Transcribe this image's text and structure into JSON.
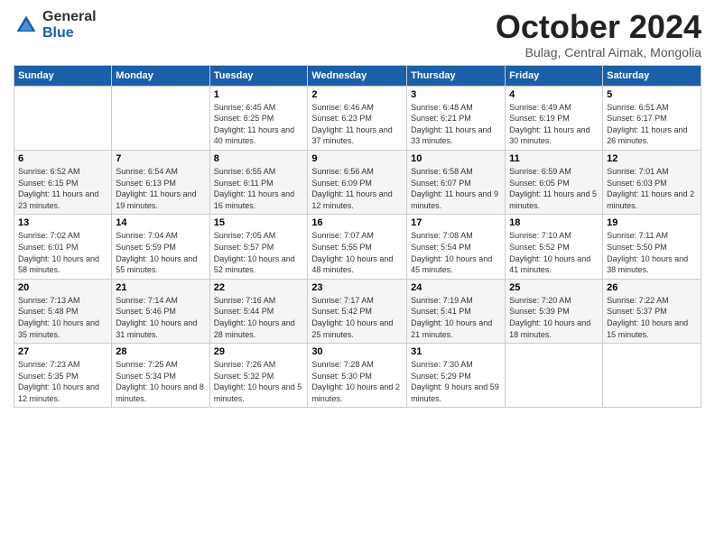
{
  "logo": {
    "general": "General",
    "blue": "Blue"
  },
  "header": {
    "month": "October 2024",
    "location": "Bulag, Central Aimak, Mongolia"
  },
  "weekdays": [
    "Sunday",
    "Monday",
    "Tuesday",
    "Wednesday",
    "Thursday",
    "Friday",
    "Saturday"
  ],
  "weeks": [
    [
      {
        "day": "",
        "info": ""
      },
      {
        "day": "",
        "info": ""
      },
      {
        "day": "1",
        "info": "Sunrise: 6:45 AM\nSunset: 6:25 PM\nDaylight: 11 hours and 40 minutes."
      },
      {
        "day": "2",
        "info": "Sunrise: 6:46 AM\nSunset: 6:23 PM\nDaylight: 11 hours and 37 minutes."
      },
      {
        "day": "3",
        "info": "Sunrise: 6:48 AM\nSunset: 6:21 PM\nDaylight: 11 hours and 33 minutes."
      },
      {
        "day": "4",
        "info": "Sunrise: 6:49 AM\nSunset: 6:19 PM\nDaylight: 11 hours and 30 minutes."
      },
      {
        "day": "5",
        "info": "Sunrise: 6:51 AM\nSunset: 6:17 PM\nDaylight: 11 hours and 26 minutes."
      }
    ],
    [
      {
        "day": "6",
        "info": "Sunrise: 6:52 AM\nSunset: 6:15 PM\nDaylight: 11 hours and 23 minutes."
      },
      {
        "day": "7",
        "info": "Sunrise: 6:54 AM\nSunset: 6:13 PM\nDaylight: 11 hours and 19 minutes."
      },
      {
        "day": "8",
        "info": "Sunrise: 6:55 AM\nSunset: 6:11 PM\nDaylight: 11 hours and 16 minutes."
      },
      {
        "day": "9",
        "info": "Sunrise: 6:56 AM\nSunset: 6:09 PM\nDaylight: 11 hours and 12 minutes."
      },
      {
        "day": "10",
        "info": "Sunrise: 6:58 AM\nSunset: 6:07 PM\nDaylight: 11 hours and 9 minutes."
      },
      {
        "day": "11",
        "info": "Sunrise: 6:59 AM\nSunset: 6:05 PM\nDaylight: 11 hours and 5 minutes."
      },
      {
        "day": "12",
        "info": "Sunrise: 7:01 AM\nSunset: 6:03 PM\nDaylight: 11 hours and 2 minutes."
      }
    ],
    [
      {
        "day": "13",
        "info": "Sunrise: 7:02 AM\nSunset: 6:01 PM\nDaylight: 10 hours and 58 minutes."
      },
      {
        "day": "14",
        "info": "Sunrise: 7:04 AM\nSunset: 5:59 PM\nDaylight: 10 hours and 55 minutes."
      },
      {
        "day": "15",
        "info": "Sunrise: 7:05 AM\nSunset: 5:57 PM\nDaylight: 10 hours and 52 minutes."
      },
      {
        "day": "16",
        "info": "Sunrise: 7:07 AM\nSunset: 5:55 PM\nDaylight: 10 hours and 48 minutes."
      },
      {
        "day": "17",
        "info": "Sunrise: 7:08 AM\nSunset: 5:54 PM\nDaylight: 10 hours and 45 minutes."
      },
      {
        "day": "18",
        "info": "Sunrise: 7:10 AM\nSunset: 5:52 PM\nDaylight: 10 hours and 41 minutes."
      },
      {
        "day": "19",
        "info": "Sunrise: 7:11 AM\nSunset: 5:50 PM\nDaylight: 10 hours and 38 minutes."
      }
    ],
    [
      {
        "day": "20",
        "info": "Sunrise: 7:13 AM\nSunset: 5:48 PM\nDaylight: 10 hours and 35 minutes."
      },
      {
        "day": "21",
        "info": "Sunrise: 7:14 AM\nSunset: 5:46 PM\nDaylight: 10 hours and 31 minutes."
      },
      {
        "day": "22",
        "info": "Sunrise: 7:16 AM\nSunset: 5:44 PM\nDaylight: 10 hours and 28 minutes."
      },
      {
        "day": "23",
        "info": "Sunrise: 7:17 AM\nSunset: 5:42 PM\nDaylight: 10 hours and 25 minutes."
      },
      {
        "day": "24",
        "info": "Sunrise: 7:19 AM\nSunset: 5:41 PM\nDaylight: 10 hours and 21 minutes."
      },
      {
        "day": "25",
        "info": "Sunrise: 7:20 AM\nSunset: 5:39 PM\nDaylight: 10 hours and 18 minutes."
      },
      {
        "day": "26",
        "info": "Sunrise: 7:22 AM\nSunset: 5:37 PM\nDaylight: 10 hours and 15 minutes."
      }
    ],
    [
      {
        "day": "27",
        "info": "Sunrise: 7:23 AM\nSunset: 5:35 PM\nDaylight: 10 hours and 12 minutes."
      },
      {
        "day": "28",
        "info": "Sunrise: 7:25 AM\nSunset: 5:34 PM\nDaylight: 10 hours and 8 minutes."
      },
      {
        "day": "29",
        "info": "Sunrise: 7:26 AM\nSunset: 5:32 PM\nDaylight: 10 hours and 5 minutes."
      },
      {
        "day": "30",
        "info": "Sunrise: 7:28 AM\nSunset: 5:30 PM\nDaylight: 10 hours and 2 minutes."
      },
      {
        "day": "31",
        "info": "Sunrise: 7:30 AM\nSunset: 5:29 PM\nDaylight: 9 hours and 59 minutes."
      },
      {
        "day": "",
        "info": ""
      },
      {
        "day": "",
        "info": ""
      }
    ]
  ]
}
